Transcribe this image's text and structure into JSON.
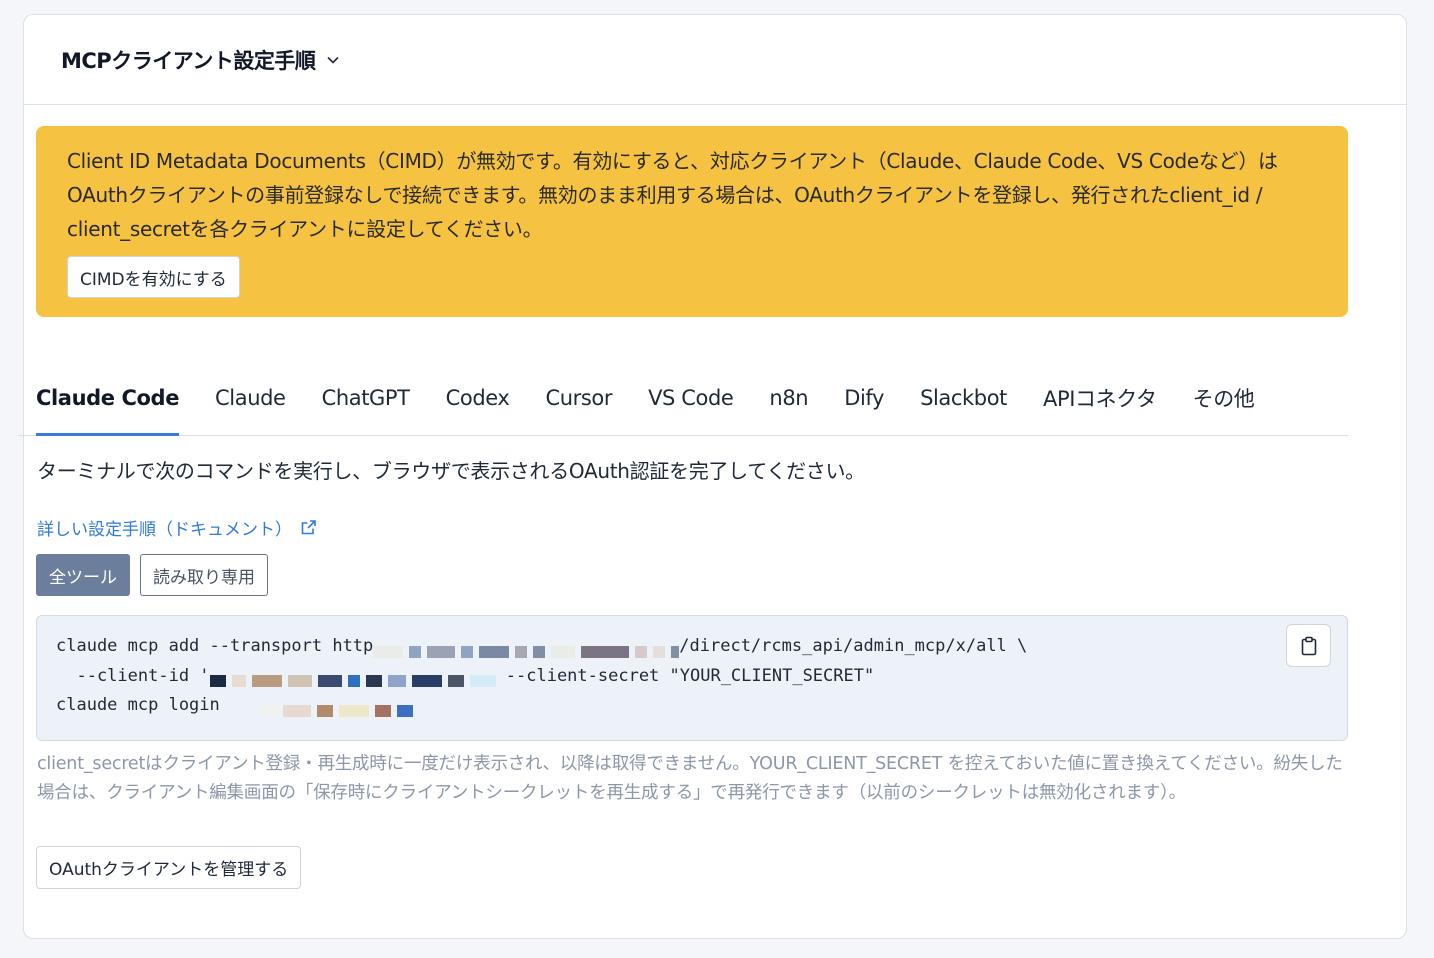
{
  "header": {
    "title": "MCPクライアント設定手順"
  },
  "alert": {
    "message": "Client ID Metadata Documents（CIMD）が無効です。有効にすると、対応クライアント（Claude、Claude Code、VS Codeなど）はOAuthクライアントの事前登録なしで接続できます。無効のまま利用する場合は、OAuthクライアントを登録し、発行されたclient_id / client_secretを各クライアントに設定してください。",
    "button_label": "CIMDを有効にする"
  },
  "tabs": [
    {
      "label": "Claude Code",
      "active": true
    },
    {
      "label": "Claude"
    },
    {
      "label": "ChatGPT"
    },
    {
      "label": "Codex"
    },
    {
      "label": "Cursor"
    },
    {
      "label": "VS Code"
    },
    {
      "label": "n8n"
    },
    {
      "label": "Dify"
    },
    {
      "label": "Slackbot"
    },
    {
      "label": "APIコネクタ"
    },
    {
      "label": "その他"
    }
  ],
  "content": {
    "description": "ターミナルで次のコマンドを実行し、ブラウザで表示されるOAuth認証を完了してください。",
    "doc_link": "詳しい設定手順（ドキュメント）",
    "toggle": {
      "all_tools": "全ツール",
      "read_only": "読み取り専用",
      "selected": "全ツール"
    },
    "code": {
      "line1_prefix": "claude mcp add --transport http",
      "line1_suffix": "/direct/rcms_api/admin_mcp/x/all \\",
      "line2_prefix": "  --client-id '",
      "line2_suffix": " --client-secret \"YOUR_CLIENT_SECRET\"",
      "line3_prefix": "claude mcp login"
    },
    "note": "client_secretはクライアント登録・再生成時に一度だけ表示され、以降は取得できません。YOUR_CLIENT_SECRET を控えておいた値に置き換えてください。紛失した場合は、クライアント編集画面の「保存時にクライアントシークレットを再生成する」で再発行できます（以前のシークレットは無効化されます）。",
    "manage_button": "OAuthクライアントを管理する"
  },
  "colors": {
    "alert_bg": "#f5c242",
    "accent": "#3a7bd5",
    "toggle_on": "#6b7f9c",
    "link": "#2f7bd7"
  }
}
